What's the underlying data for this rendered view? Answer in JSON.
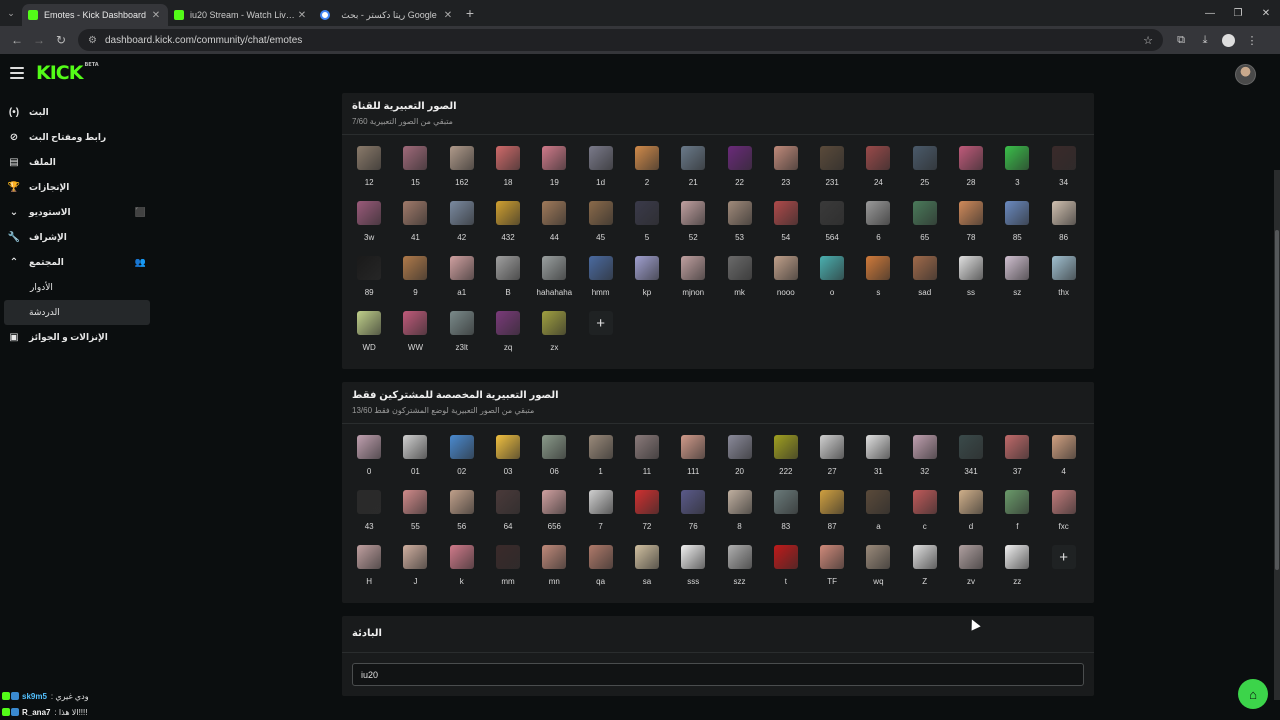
{
  "browser": {
    "tabs": [
      {
        "title": "Emotes - Kick Dashboard",
        "favicon": "kick-icon",
        "active": true
      },
      {
        "title": "iu20 Stream - Watch Live on Kick",
        "favicon": "kick-icon",
        "active": false
      },
      {
        "title": "ريتا دكستر - بحث Google",
        "favicon": "google-icon",
        "active": false
      }
    ],
    "url": "dashboard.kick.com/community/chat/emotes"
  },
  "header": {
    "logo": "KICK",
    "logo_badge": "BETA"
  },
  "sidebar": {
    "items": [
      {
        "label": "البث",
        "icon": "broadcast-icon"
      },
      {
        "label": "رابط ومفتاح البث",
        "icon": "link-icon"
      },
      {
        "label": "الملف",
        "icon": "file-icon"
      },
      {
        "label": "الإنجازات",
        "icon": "trophy-icon"
      },
      {
        "label": "الاستوديو",
        "icon": "chevron-down-icon",
        "extra": "⬛"
      },
      {
        "label": "الإشراف",
        "icon": "wrench-icon"
      },
      {
        "label": "المجتمع",
        "icon": "chevron-up-icon",
        "extra": "👥"
      },
      {
        "label": "الأدوار",
        "sub": true
      },
      {
        "label": "الدردشة",
        "sub": true,
        "active": true
      },
      {
        "label": "الإنزالات و الجوائز",
        "icon": "gift-icon"
      }
    ]
  },
  "channel_emotes": {
    "title": "الصور التعبيرية للقناة",
    "subtitle": "متبقي من الصور التعبيرية 7/60",
    "emotes": [
      {
        "name": "12",
        "color": "#8a7a6a"
      },
      {
        "name": "15",
        "color": "#a06a7a"
      },
      {
        "name": "162",
        "color": "#b09a8a"
      },
      {
        "name": "18",
        "color": "#d06a6a"
      },
      {
        "name": "19",
        "color": "#d07a8a"
      },
      {
        "name": "1d",
        "color": "#7a7a8a"
      },
      {
        "name": "2",
        "color": "#d08a4a"
      },
      {
        "name": "21",
        "color": "#6a7a8a"
      },
      {
        "name": "22",
        "color": "#6a2a7a"
      },
      {
        "name": "23",
        "color": "#c08a7a"
      },
      {
        "name": "231",
        "color": "#5a4a3a"
      },
      {
        "name": "24",
        "color": "#9a4a4a"
      },
      {
        "name": "25",
        "color": "#4a5a6a"
      },
      {
        "name": "28",
        "color": "#c05a7a"
      },
      {
        "name": "3",
        "color": "#3ac04a"
      },
      {
        "name": "34",
        "color": "#3a2a2a"
      },
      {
        "name": "3w",
        "color": "#9a5a7a"
      },
      {
        "name": "41",
        "color": "#a07a6a"
      },
      {
        "name": "42",
        "color": "#7a8aa0"
      },
      {
        "name": "432",
        "color": "#d0a030"
      },
      {
        "name": "44",
        "color": "#a07a5a"
      },
      {
        "name": "45",
        "color": "#8a6a4a"
      },
      {
        "name": "5",
        "color": "#3a3a4a"
      },
      {
        "name": "52",
        "color": "#c0a0a0"
      },
      {
        "name": "53",
        "color": "#a08a7a"
      },
      {
        "name": "54",
        "color": "#b04a4a"
      },
      {
        "name": "564",
        "color": "#3a3a3a"
      },
      {
        "name": "6",
        "color": "#9a9a9a"
      },
      {
        "name": "65",
        "color": "#4a7a5a"
      },
      {
        "name": "78",
        "color": "#d08a5a"
      },
      {
        "name": "85",
        "color": "#6a8ac0"
      },
      {
        "name": "86",
        "color": "#d0c0b0"
      },
      {
        "name": "89",
        "color": "#1a1a1a"
      },
      {
        "name": "9",
        "color": "#b07a4a"
      },
      {
        "name": "a1",
        "color": "#d0a0a0"
      },
      {
        "name": "B",
        "color": "#a0a0a0"
      },
      {
        "name": "hahahaha",
        "color": "#9aa0a0"
      },
      {
        "name": "hmm",
        "color": "#4a6aa0"
      },
      {
        "name": "kp",
        "color": "#a0a0d0"
      },
      {
        "name": "mjnon",
        "color": "#c0a0a0"
      },
      {
        "name": "mk",
        "color": "#6a6a6a"
      },
      {
        "name": "nooo",
        "color": "#c0a08a"
      },
      {
        "name": "o",
        "color": "#4ab0b0"
      },
      {
        "name": "s",
        "color": "#d07a3a"
      },
      {
        "name": "sad",
        "color": "#a06a4a"
      },
      {
        "name": "ss",
        "color": "#e0e0e0"
      },
      {
        "name": "sz",
        "color": "#d0c0d0"
      },
      {
        "name": "thx",
        "color": "#a0c0d0"
      },
      {
        "name": "WD",
        "color": "#c0d08a"
      },
      {
        "name": "WW",
        "color": "#c05a7a"
      },
      {
        "name": "z3lt",
        "color": "#7a8a8a"
      },
      {
        "name": "zq",
        "color": "#7a3a7a"
      },
      {
        "name": "zx",
        "color": "#a0a040"
      }
    ],
    "add_label": "+"
  },
  "subscriber_emotes": {
    "title": "الصور التعبيرية المخصصة للمشتركين فقط",
    "subtitle": "متبقي من الصور التعبيرية لوضع المشتركون فقط 13/60",
    "emotes": [
      {
        "name": "0",
        "color": "#c0a0b0"
      },
      {
        "name": "01",
        "color": "#d0d0d0"
      },
      {
        "name": "02",
        "color": "#4a8ad0"
      },
      {
        "name": "03",
        "color": "#f0c040"
      },
      {
        "name": "06",
        "color": "#8a9a8a"
      },
      {
        "name": "1",
        "color": "#9a8a7a"
      },
      {
        "name": "11",
        "color": "#8a7a7a"
      },
      {
        "name": "111",
        "color": "#d09a8a"
      },
      {
        "name": "20",
        "color": "#8a8a9a"
      },
      {
        "name": "222",
        "color": "#a0a020"
      },
      {
        "name": "27",
        "color": "#d0d0d0"
      },
      {
        "name": "31",
        "color": "#e0e0e0"
      },
      {
        "name": "32",
        "color": "#c0a0b0"
      },
      {
        "name": "341",
        "color": "#3a4a4a"
      },
      {
        "name": "37",
        "color": "#c06a6a"
      },
      {
        "name": "4",
        "color": "#d0a080"
      },
      {
        "name": "43",
        "color": "#2a2a2a"
      },
      {
        "name": "55",
        "color": "#d08a8a"
      },
      {
        "name": "56",
        "color": "#c0a08a"
      },
      {
        "name": "64",
        "color": "#4a3a3a"
      },
      {
        "name": "656",
        "color": "#d0a0a0"
      },
      {
        "name": "7",
        "color": "#d0d0d0"
      },
      {
        "name": "72",
        "color": "#d03030"
      },
      {
        "name": "76",
        "color": "#5a5a8a"
      },
      {
        "name": "8",
        "color": "#c0b0a0"
      },
      {
        "name": "83",
        "color": "#6a7a7a"
      },
      {
        "name": "87",
        "color": "#d0a040"
      },
      {
        "name": "a",
        "color": "#5a4a3a"
      },
      {
        "name": "c",
        "color": "#c05a5a"
      },
      {
        "name": "d",
        "color": "#d0b08a"
      },
      {
        "name": "f",
        "color": "#6a9a6a"
      },
      {
        "name": "fxc",
        "color": "#c07a7a"
      },
      {
        "name": "H",
        "color": "#c0a0a0"
      },
      {
        "name": "J",
        "color": "#d0b0a0"
      },
      {
        "name": "k",
        "color": "#d07a8a"
      },
      {
        "name": "mm",
        "color": "#3a2a2a"
      },
      {
        "name": "mn",
        "color": "#c08a7a"
      },
      {
        "name": "qa",
        "color": "#b07a6a"
      },
      {
        "name": "sa",
        "color": "#d0c0a0"
      },
      {
        "name": "sss",
        "color": "#f0f0f0"
      },
      {
        "name": "szz",
        "color": "#b0b0b0"
      },
      {
        "name": "t",
        "color": "#c01a1a"
      },
      {
        "name": "TF",
        "color": "#d08a7a"
      },
      {
        "name": "wq",
        "color": "#9a8a7a"
      },
      {
        "name": "Z",
        "color": "#e0e0e0"
      },
      {
        "name": "zv",
        "color": "#b0a0a0"
      },
      {
        "name": "zz",
        "color": "#f0f0f0"
      }
    ],
    "add_label": "+"
  },
  "prefix": {
    "title": "البادئة",
    "value": "iu20"
  },
  "chat_overlay": [
    {
      "user": "sk9m5",
      "message": ": ودي غيري",
      "user_color": "#53c1ff"
    },
    {
      "user": "R_ana7",
      "message": ": الا هذا!!!!",
      "user_color": "#f0f0f0"
    }
  ],
  "colors": {
    "brand": "#53fc18",
    "background": "#0b0e0f",
    "card": "#191b1c"
  }
}
